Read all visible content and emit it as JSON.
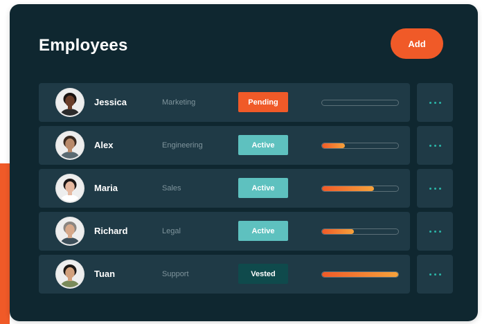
{
  "page": {
    "title": "Employees",
    "add_label": "Add"
  },
  "colors": {
    "card_bg": "#0f2730",
    "row_bg": "#1f3a46",
    "accent": "#f05a28",
    "progress_end": "#f6a23b",
    "status_pending": "#f05a28",
    "status_active": "#5ec1bf",
    "status_vested": "#0f4a4c",
    "more_dots": "#2bb6a8"
  },
  "employees": [
    {
      "name": "Jessica",
      "department": "Marketing",
      "status": "Pending",
      "status_color": "#f05a28",
      "progress": 0.0,
      "avatar_icon": "woman-avatar-icon",
      "skin": "#6b3e2a",
      "hair": "#1a1412",
      "shirt": "#2b2b2b"
    },
    {
      "name": "Alex",
      "department": "Engineering",
      "status": "Active",
      "status_color": "#5ec1bf",
      "progress": 0.3,
      "avatar_icon": "man-avatar-icon",
      "skin": "#b98a6b",
      "hair": "#3a2a20",
      "shirt": "#5a6a72"
    },
    {
      "name": "Maria",
      "department": "Sales",
      "status": "Active",
      "status_color": "#5ec1bf",
      "progress": 0.68,
      "avatar_icon": "woman-avatar-icon",
      "skin": "#e5b8a0",
      "hair": "#1b1616",
      "shirt": "#ffffff"
    },
    {
      "name": "Richard",
      "department": "Legal",
      "status": "Active",
      "status_color": "#5ec1bf",
      "progress": 0.42,
      "avatar_icon": "man-avatar-icon",
      "skin": "#d6a88a",
      "hair": "#8a8580",
      "shirt": "#3d4f5a"
    },
    {
      "name": "Tuan",
      "department": "Support",
      "status": "Vested",
      "status_color": "#0f4a4c",
      "progress": 1.0,
      "avatar_icon": "man-avatar-icon",
      "skin": "#d2a07c",
      "hair": "#1c1714",
      "shirt": "#7a8a5a"
    }
  ],
  "row_actions_icon": "more-horizontal-icon"
}
